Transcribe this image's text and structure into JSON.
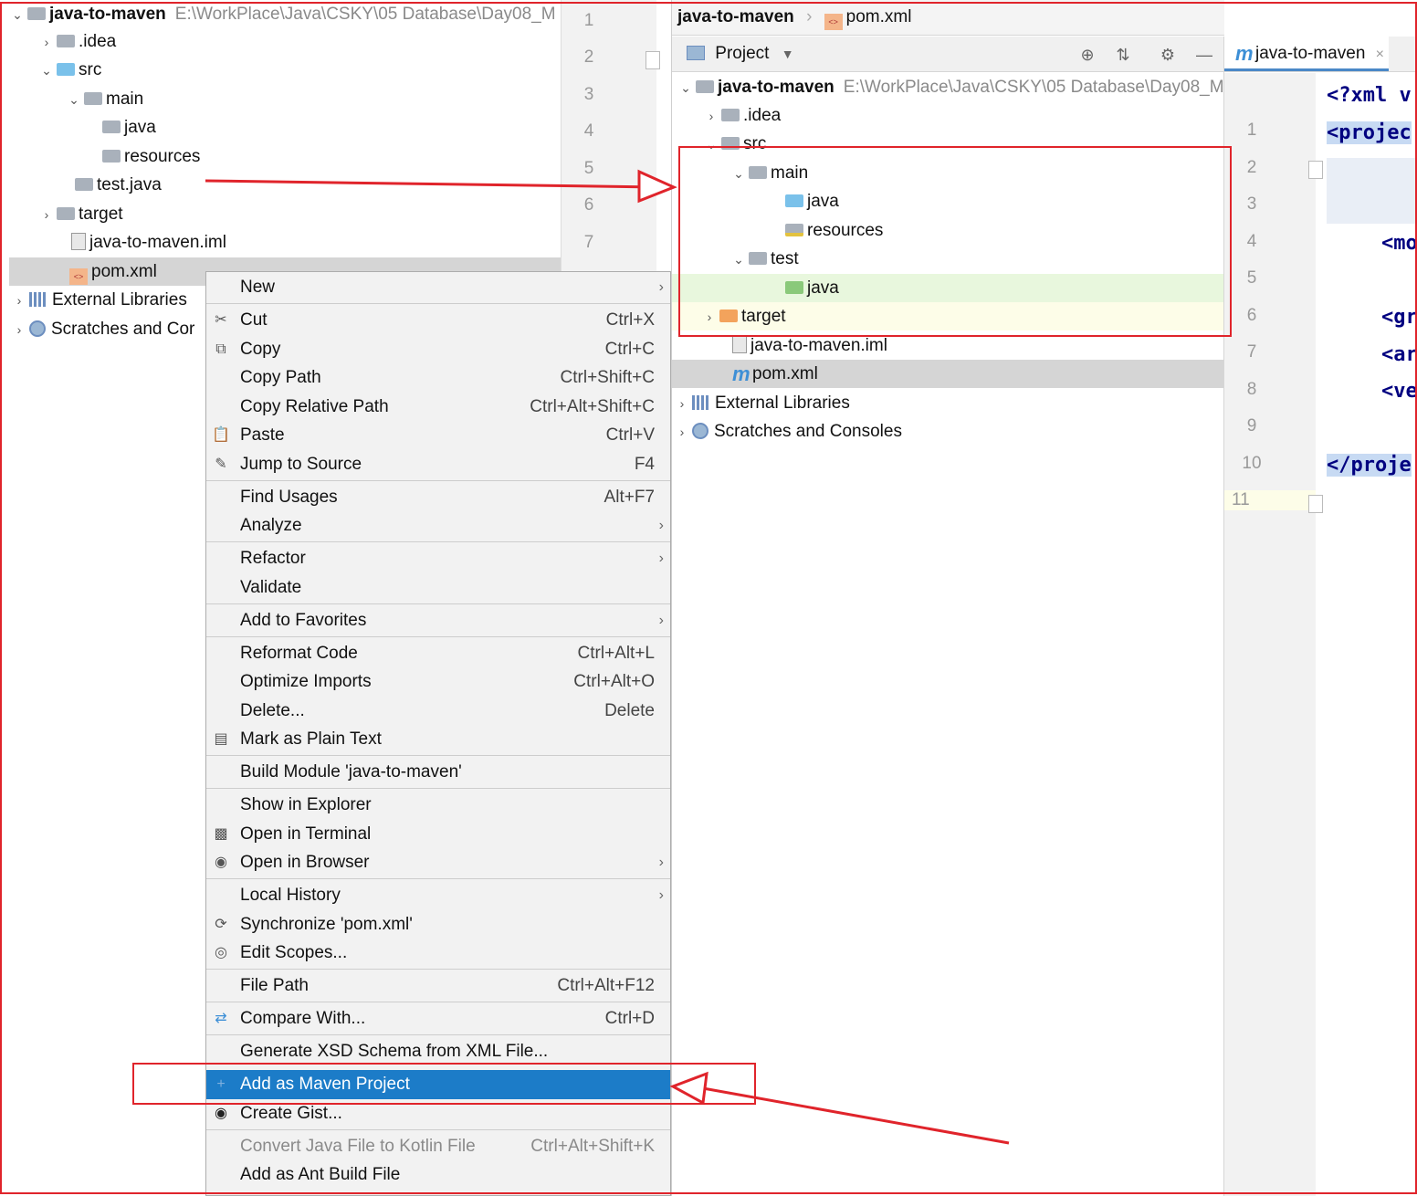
{
  "left_tree": {
    "root": {
      "name": "java-to-maven",
      "path": "E:\\WorkPlace\\Java\\CSKY\\05 Database\\Day08_M"
    },
    "items": [
      {
        "label": ".idea"
      },
      {
        "label": "src"
      },
      {
        "label": "main"
      },
      {
        "label": "java"
      },
      {
        "label": "resources"
      },
      {
        "label": "test.java"
      },
      {
        "label": "target"
      },
      {
        "label": "java-to-maven.iml"
      },
      {
        "label": "pom.xml"
      },
      {
        "label": "External Libraries"
      },
      {
        "label": "Scratches and Cor"
      }
    ],
    "line_numbers": [
      "1",
      "2",
      "3",
      "4",
      "5",
      "6",
      "7"
    ]
  },
  "context_menu": {
    "items": [
      {
        "label": "New",
        "shortcut": ""
      },
      {
        "label": "Cut",
        "shortcut": "Ctrl+X"
      },
      {
        "label": "Copy",
        "shortcut": "Ctrl+C"
      },
      {
        "label": "Copy Path",
        "shortcut": "Ctrl+Shift+C"
      },
      {
        "label": "Copy Relative Path",
        "shortcut": "Ctrl+Alt+Shift+C"
      },
      {
        "label": "Paste",
        "shortcut": "Ctrl+V"
      },
      {
        "label": "Jump to Source",
        "shortcut": "F4"
      },
      {
        "label": "Find Usages",
        "shortcut": "Alt+F7"
      },
      {
        "label": "Analyze",
        "shortcut": ""
      },
      {
        "label": "Refactor",
        "shortcut": ""
      },
      {
        "label": "Validate",
        "shortcut": ""
      },
      {
        "label": "Add to Favorites",
        "shortcut": ""
      },
      {
        "label": "Reformat Code",
        "shortcut": "Ctrl+Alt+L"
      },
      {
        "label": "Optimize Imports",
        "shortcut": "Ctrl+Alt+O"
      },
      {
        "label": "Delete...",
        "shortcut": "Delete"
      },
      {
        "label": "Mark as Plain Text",
        "shortcut": ""
      },
      {
        "label": "Build Module 'java-to-maven'",
        "shortcut": ""
      },
      {
        "label": "Show in Explorer",
        "shortcut": ""
      },
      {
        "label": "Open in Terminal",
        "shortcut": ""
      },
      {
        "label": "Open in Browser",
        "shortcut": ""
      },
      {
        "label": "Local History",
        "shortcut": ""
      },
      {
        "label": "Synchronize 'pom.xml'",
        "shortcut": ""
      },
      {
        "label": "Edit Scopes...",
        "shortcut": ""
      },
      {
        "label": "File Path",
        "shortcut": "Ctrl+Alt+F12"
      },
      {
        "label": "Compare With...",
        "shortcut": "Ctrl+D"
      },
      {
        "label": "Generate XSD Schema from XML File...",
        "shortcut": ""
      },
      {
        "label": "Add as Maven Project",
        "shortcut": ""
      },
      {
        "label": "Create Gist...",
        "shortcut": ""
      },
      {
        "label": "Convert Java File to Kotlin File",
        "shortcut": "Ctrl+Alt+Shift+K"
      },
      {
        "label": "Add as Ant Build File",
        "shortcut": ""
      }
    ],
    "selected": "Add as Maven Project"
  },
  "right_pane": {
    "breadcrumb": {
      "project": "java-to-maven",
      "file": "pom.xml"
    },
    "tool_title": "Project",
    "root": {
      "name": "java-to-maven",
      "path": "E:\\WorkPlace\\Java\\CSKY\\05 Database\\Day08_M"
    },
    "items": [
      {
        "label": ".idea"
      },
      {
        "label": "src"
      },
      {
        "label": "main"
      },
      {
        "label": "java"
      },
      {
        "label": "resources"
      },
      {
        "label": "test"
      },
      {
        "label": "java"
      },
      {
        "label": "target"
      },
      {
        "label": "java-to-maven.iml"
      },
      {
        "label": "pom.xml"
      },
      {
        "label": "External Libraries"
      },
      {
        "label": "Scratches and Consoles"
      }
    ]
  },
  "editor": {
    "tab": "java-to-maven",
    "line_numbers": [
      "1",
      "2",
      "3",
      "4",
      "5",
      "6",
      "7",
      "8",
      "9",
      "10",
      "11"
    ],
    "code": [
      "<?xml v",
      "<projec",
      "<mo",
      "<gr",
      "<ar",
      "<ve",
      "</proje"
    ]
  },
  "colors": {
    "accent": "#1c7cc8",
    "annotation": "#e0242b",
    "highlight_green": "#e8f7dd",
    "highlight_yellow": "#fdfde8"
  }
}
